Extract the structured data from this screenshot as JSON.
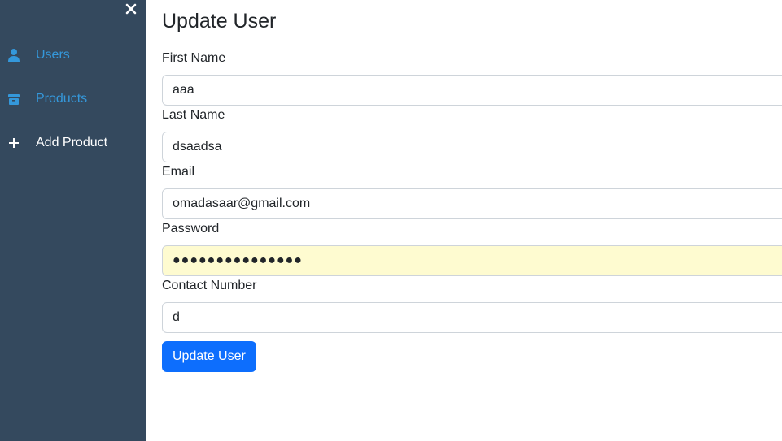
{
  "sidebar": {
    "close_icon": "close-icon",
    "items": [
      {
        "label": "Users",
        "icon": "user-icon",
        "active": true
      },
      {
        "label": "Products",
        "icon": "box-icon",
        "active": true
      },
      {
        "label": "Add Product",
        "icon": "plus-icon",
        "active": false
      }
    ]
  },
  "main": {
    "title": "Update User",
    "form": {
      "first_name": {
        "label": "First Name",
        "value": "aaa"
      },
      "last_name": {
        "label": "Last Name",
        "value": "dsaadsa"
      },
      "email": {
        "label": "Email",
        "value": "omadasaar@gmail.com"
      },
      "password": {
        "label": "Password",
        "value": "●●●●●●●●●●●●●●●"
      },
      "contact_number": {
        "label": "Contact Number",
        "value": "d"
      },
      "submit_label": "Update User"
    }
  },
  "colors": {
    "sidebar_bg": "#34495e",
    "active_link": "#3498db",
    "primary_button": "#0d6efd",
    "autofill_bg": "#fefbd0"
  }
}
